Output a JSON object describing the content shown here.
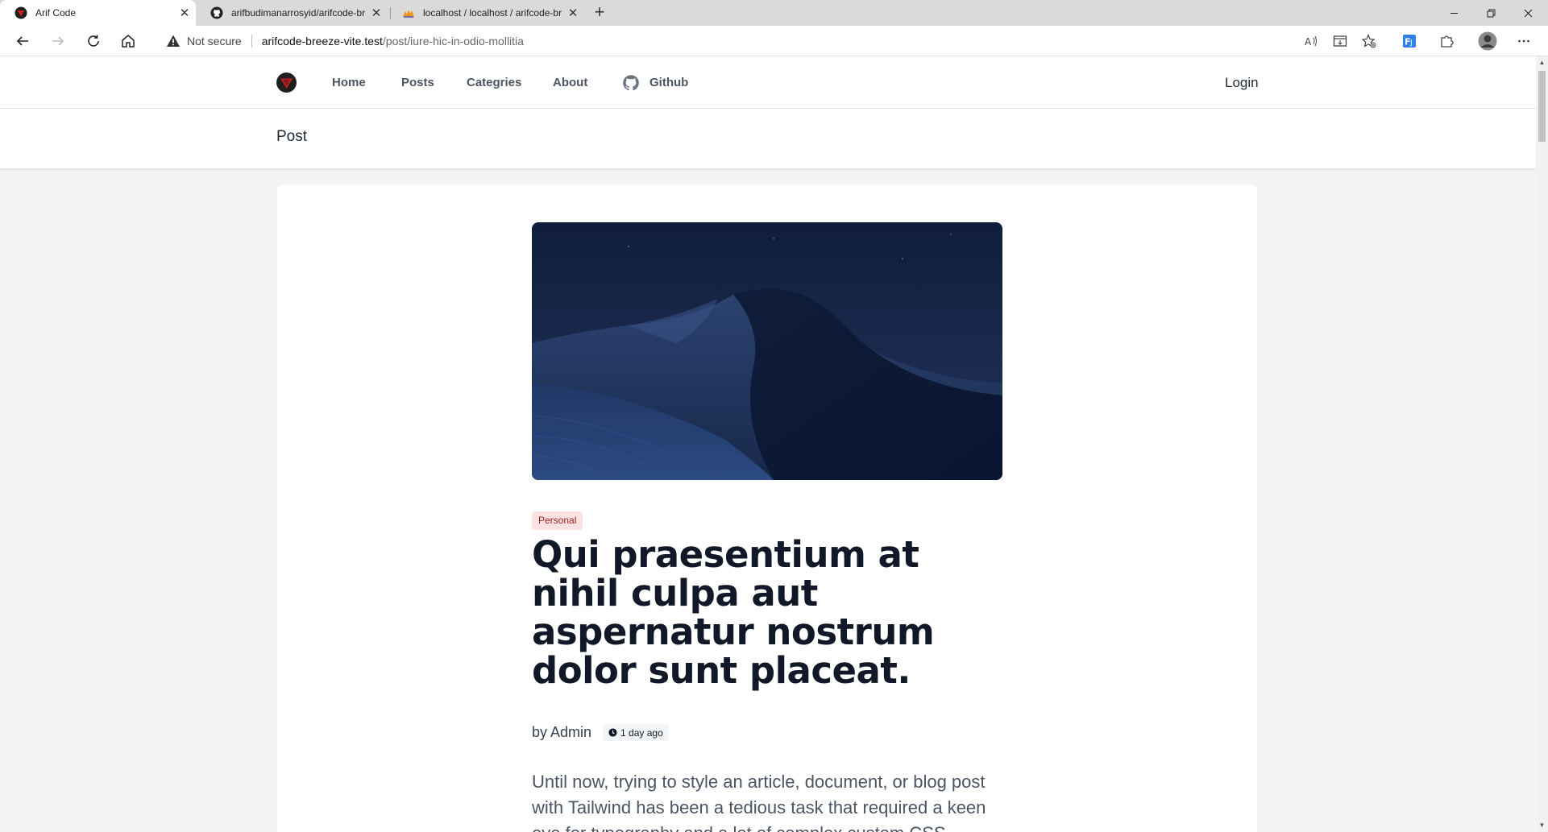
{
  "browser": {
    "tabs": [
      {
        "title": "Arif Code",
        "icon": "site-logo-icon"
      },
      {
        "title": "arifbudimanarrosyid/arifcode-breeze-vite",
        "icon": "github-icon"
      },
      {
        "title": "localhost / localhost / arifcode-breeze-vite",
        "icon": "phpmyadmin-icon"
      }
    ],
    "new_tab_label": "+",
    "address": {
      "security_label": "Not secure",
      "host": "arifcode-breeze-vite.test",
      "path": "/post/iure-hic-in-odio-mollitia"
    }
  },
  "site": {
    "nav": {
      "links": [
        "Home",
        "Posts",
        "Categries",
        "About",
        "Github"
      ],
      "login": "Login"
    },
    "page_header": "Post",
    "post": {
      "category": "Personal",
      "title": "Qui praesentium at nihil culpa aut aspernatur nostrum dolor sunt placeat.",
      "byline": "by Admin",
      "time": "1 day ago",
      "body": "Until now, trying to style an article, document, or blog post with Tailwind has been a tedious task that required a keen eye for typography and a lot of complex custom CSS."
    }
  },
  "colors": {
    "badge_bg": "#fee2e2",
    "badge_text": "#991b1b",
    "page_bg": "#f3f4f6",
    "logo_red": "#b91c1c"
  }
}
